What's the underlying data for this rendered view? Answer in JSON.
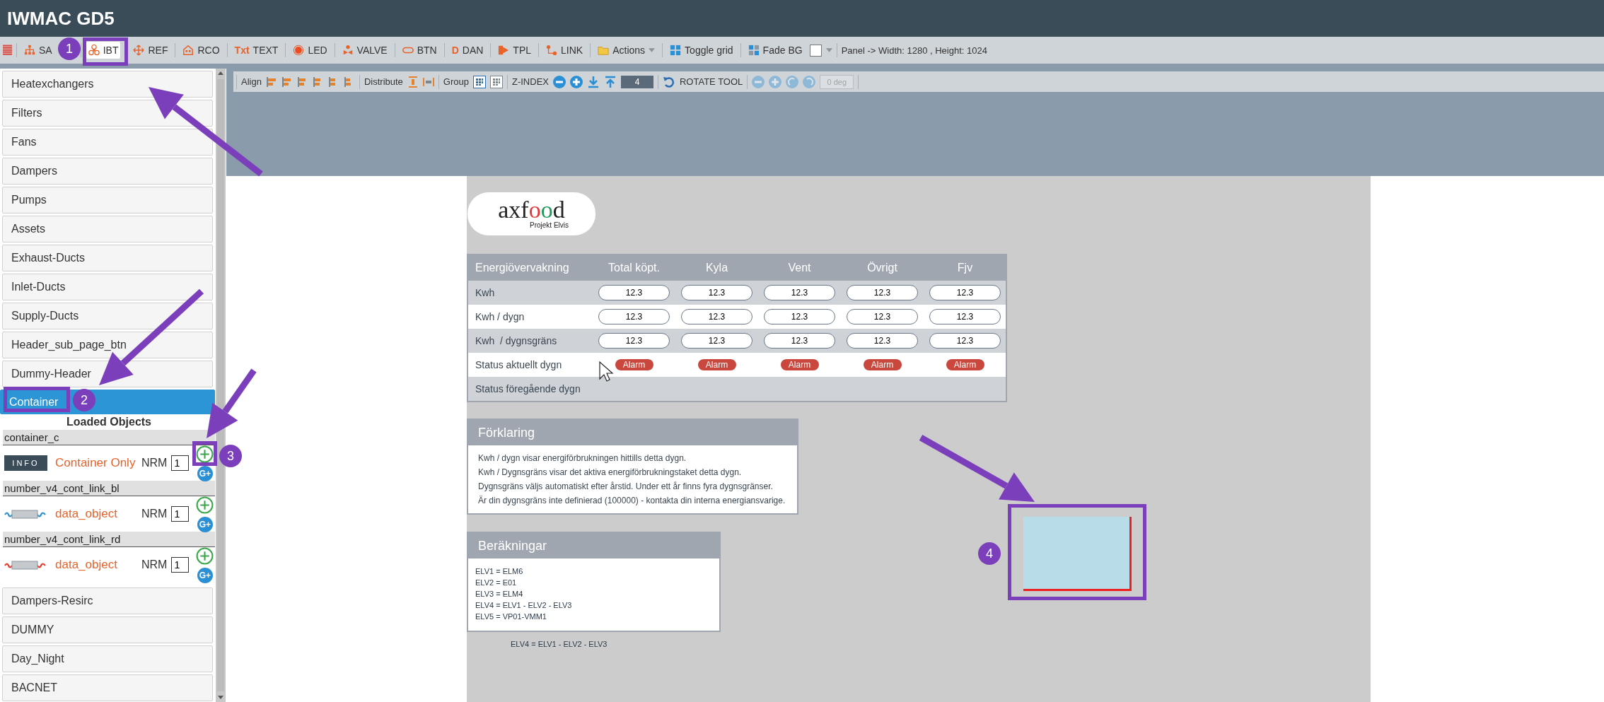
{
  "window": {
    "title": "IWMAC GD5"
  },
  "toolbar": {
    "tools": [
      {
        "label": "SA",
        "selected": false
      },
      {
        "label": "IBT",
        "selected": true
      },
      {
        "label": "REF",
        "selected": false
      },
      {
        "label": "RCO",
        "selected": false
      },
      {
        "label": "TEXT",
        "prefix": "Txt",
        "selected": false
      },
      {
        "label": "LED",
        "selected": false
      },
      {
        "label": "VALVE",
        "selected": false
      },
      {
        "label": "BTN",
        "selected": false
      },
      {
        "label": "DAN",
        "prefix": "D",
        "selected": false
      },
      {
        "label": "TPL",
        "selected": false
      },
      {
        "label": "LINK",
        "selected": false
      },
      {
        "label": "Actions",
        "selected": false
      },
      {
        "label": "Toggle grid",
        "selected": false
      },
      {
        "label": "Fade BG",
        "selected": false
      }
    ],
    "checkbox_checked": false,
    "panel_info": "Panel -> Width: 1280 , Height: 1024"
  },
  "align_toolbar": {
    "align": "Align",
    "distribute": "Distribute",
    "group": "Group",
    "z_index": "Z-INDEX",
    "z_value": "4",
    "rotate": "ROTATE TOOL",
    "rotate_value": "0 deg",
    "rotate_disabled": true
  },
  "sidebar": {
    "items": [
      {
        "label": "Heatexchangers",
        "selected": false
      },
      {
        "label": "Filters",
        "selected": false
      },
      {
        "label": "Fans",
        "selected": false
      },
      {
        "label": "Dampers",
        "selected": false
      },
      {
        "label": "Pumps",
        "selected": false
      },
      {
        "label": "Assets",
        "selected": false
      },
      {
        "label": "Exhaust-Ducts",
        "selected": false
      },
      {
        "label": "Inlet-Ducts",
        "selected": false
      },
      {
        "label": "Supply-Ducts",
        "selected": false
      },
      {
        "label": "Header_sub_page_btn",
        "selected": false
      },
      {
        "label": "Dummy-Header",
        "selected": false
      },
      {
        "label": "Container",
        "selected": true,
        "loaded_objects": {
          "title": "Loaded Objects",
          "objects": [
            {
              "name": "container_c",
              "kind": "info",
              "button": "INFO",
              "label": "Container Only",
              "nrm_label": "NRM",
              "nrm": "1",
              "group_add": "G+"
            },
            {
              "name": "number_v4_cont_link_bl",
              "kind": "wave",
              "color": "#2a8fd0",
              "label": "data_object",
              "nrm_label": "NRM",
              "nrm": "1",
              "group_add": "G+"
            },
            {
              "name": "number_v4_cont_link_rd",
              "kind": "wave",
              "color": "#e8382a",
              "label": "data_object",
              "nrm_label": "NRM",
              "nrm": "1",
              "group_add": "G+"
            }
          ]
        }
      },
      {
        "label": "Dampers-Resirc",
        "selected": false
      },
      {
        "label": "DUMMY",
        "selected": false
      },
      {
        "label": "Day_Night",
        "selected": false
      },
      {
        "label": "BACNET",
        "selected": false
      }
    ]
  },
  "canvas": {
    "logo": {
      "parts": [
        {
          "text": "axf",
          "color": "#222222"
        },
        {
          "text": "o",
          "color": "#e03a3a"
        },
        {
          "text": "o",
          "color": "#1f9a5a"
        },
        {
          "text": "d",
          "color": "#222222"
        }
      ],
      "subtitle": "Projekt Elvis"
    },
    "energy_table": {
      "columns": [
        "Energiövervakning",
        "Total köpt.",
        "Kyla",
        "Vent",
        "Övrigt",
        "Fjv"
      ],
      "rows": [
        {
          "label": "Kwh",
          "kind": "values",
          "cells": [
            "12.3",
            "12.3",
            "12.3",
            "12.3",
            "12.3"
          ]
        },
        {
          "label": "Kwh / dygn",
          "kind": "values",
          "cells": [
            "12.3",
            "12.3",
            "12.3",
            "12.3",
            "12.3"
          ]
        },
        {
          "label": "Kwh  / dygnsgräns",
          "kind": "values",
          "cells": [
            "12.3",
            "12.3",
            "12.3",
            "12.3",
            "12.3"
          ]
        },
        {
          "label": "Status aktuellt dygn",
          "kind": "alarms",
          "cells": [
            "Alarm",
            "Alarm",
            "Alarm",
            "Alarm",
            "Alarm"
          ]
        },
        {
          "label": "Status föregående dygn",
          "kind": "empty"
        }
      ]
    },
    "explanation": {
      "title": "Förklaring",
      "lines": [
        "Kwh / dygn visar energiförbrukningen hittills detta dygn.",
        "Kwh / Dygnsgräns visar det aktiva energiförbrukningstaket detta dygn.",
        "Dygnsgräns väljs automatiskt efter årstid. Under ett år finns fyra dygnsgränser.",
        "Är din dygnsgräns inte definierad (100000) - kontakta din interna energiansvarige."
      ]
    },
    "calculations": {
      "title": "Beräkningar",
      "lines": [
        "ELV1 = ELM6",
        "ELV2 = E01",
        "ELV3 = ELM4",
        "ELV4 = ELV1 - ELV2 - ELV3",
        "ELV5 = VP01-VMM1"
      ]
    },
    "footnote": "ELV4 = ELV1 - ELV2 - ELV3"
  },
  "annotations": [
    {
      "number": "1"
    },
    {
      "number": "2"
    },
    {
      "number": "3"
    },
    {
      "number": "4"
    }
  ]
}
